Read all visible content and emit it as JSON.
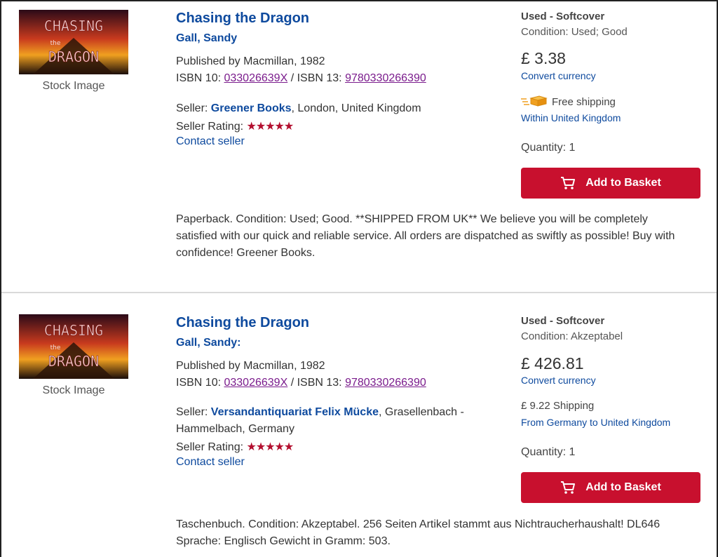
{
  "listings": [
    {
      "cover_alt": "Chasing the Dragon cover",
      "cover_text": [
        "CHASING",
        "the",
        "DRAGON"
      ],
      "stock_label": "Stock Image",
      "title": "Chasing the Dragon",
      "author": "Gall, Sandy",
      "published": "Published by Macmillan, 1982",
      "isbn10_label": "ISBN 10: ",
      "isbn10": "033026639X",
      "isbn_sep": " / ISBN 13: ",
      "isbn13": "9780330266390",
      "seller_label": "Seller: ",
      "seller_name": "Greener Books",
      "seller_location": ", London, United Kingdom",
      "seller_location_2": "",
      "rating_label": "Seller Rating: ",
      "rating_stars": "★★★★★",
      "contact": "Contact seller",
      "binding": "Used - Softcover",
      "condition": "Condition: Used; Good",
      "price": "£ 3.38",
      "convert": "Convert currency",
      "shipping": "Free shipping",
      "shipping_region": "Within United Kingdom",
      "quantity": "Quantity: 1",
      "basket_label": "Add to Basket",
      "description_lines": [
        "Paperback. Condition: Used; Good. **SHIPPED FROM UK** We believe you will be completely",
        "satisfied with our quick and reliable service. All orders are dispatched as swiftly as possible! Buy with",
        "confidence! Greener Books."
      ]
    },
    {
      "cover_alt": "Chasing the Dragon cover",
      "cover_text": [
        "CHASING",
        "the",
        "DRAGON"
      ],
      "stock_label": "Stock Image",
      "title": "Chasing the Dragon",
      "author": "Gall, Sandy:",
      "published": "Published by Macmillan, 1982",
      "isbn10_label": "ISBN 10: ",
      "isbn10": "033026639X",
      "isbn_sep": " / ISBN 13: ",
      "isbn13": "9780330266390",
      "seller_label": "Seller: ",
      "seller_name": "Versandantiquariat Felix Mücke",
      "seller_location": ", Grasellenbach -",
      "seller_location_2": "Hammelbach, Germany",
      "rating_label": "Seller Rating: ",
      "rating_stars": "★★★★★",
      "contact": "Contact seller",
      "binding": "Used - Softcover",
      "condition": "Condition: Akzeptabel",
      "price": "£ 426.81",
      "convert": "Convert currency",
      "shipping": "£ 9.22 Shipping",
      "shipping_region": "From Germany to United Kingdom",
      "quantity": "Quantity: 1",
      "basket_label": "Add to Basket",
      "description_lines": [
        "Taschenbuch. Condition: Akzeptabel. 256 Seiten Artikel stammt aus Nichtraucherhaushalt! DL646",
        "Sprache: Englisch Gewicht in Gramm: 503."
      ]
    }
  ],
  "colors": {
    "link_blue": "#0e4a9e",
    "visited_purple": "#7a1b8c",
    "basket_red": "#c8102e",
    "star_red": "#b30f2f"
  },
  "icons": {
    "basket": "cart-icon",
    "free_shipping": "delivery-box-icon"
  }
}
